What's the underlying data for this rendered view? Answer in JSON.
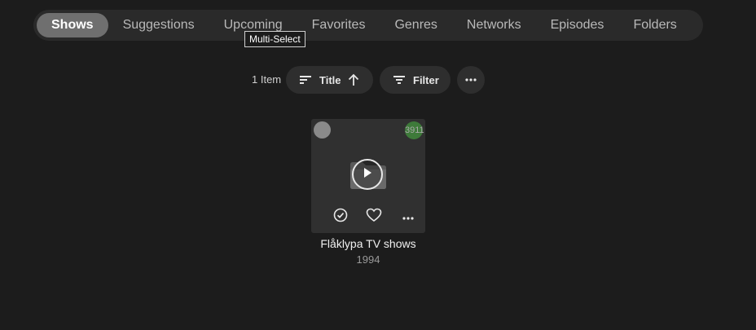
{
  "tabs": [
    {
      "label": "Shows",
      "active": true
    },
    {
      "label": "Suggestions",
      "active": false
    },
    {
      "label": "Upcoming",
      "active": false
    },
    {
      "label": "Favorites",
      "active": false
    },
    {
      "label": "Genres",
      "active": false
    },
    {
      "label": "Networks",
      "active": false
    },
    {
      "label": "Episodes",
      "active": false
    },
    {
      "label": "Folders",
      "active": false
    }
  ],
  "tooltip": "Multi-Select",
  "toolbar": {
    "item_count": "1 Item",
    "sort_label": "Title",
    "sort_direction": "ascending",
    "filter_label": "Filter"
  },
  "card": {
    "badge_count": "3911",
    "title": "Flåklypa TV shows",
    "year": "1994",
    "badge_color": "#3e7a3a"
  },
  "icons": {
    "sort": "sort-lines-icon",
    "sort_dir": "arrow-up-icon",
    "filter": "filter-icon",
    "more": "more-horizontal-icon",
    "placeholder": "folder-icon",
    "play": "play-icon",
    "played": "check-circle-icon",
    "favorite": "heart-icon"
  },
  "colors": {
    "background": "#1c1c1c",
    "tab_active": "#6f6f6f",
    "pill": "#2e2e2e"
  }
}
